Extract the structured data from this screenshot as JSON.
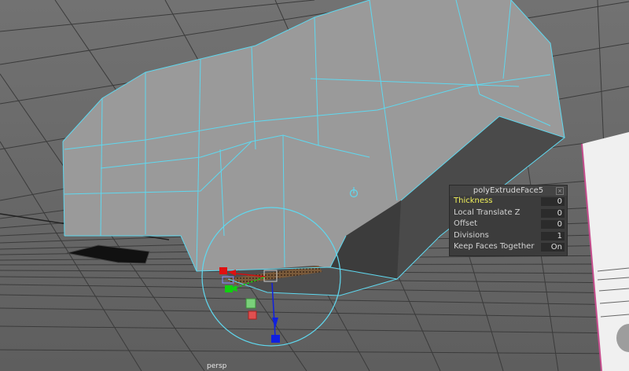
{
  "viewport": {
    "camera_label": "persp",
    "background": "#6b6b6b",
    "wire_color": "#5fd8ef"
  },
  "extrude_panel": {
    "title": "polyExtrudeFace5",
    "close_icon": "close-icon",
    "rows": [
      {
        "label": "Thickness",
        "value": "0",
        "active": true
      },
      {
        "label": "Local Translate Z",
        "value": "0",
        "active": false
      },
      {
        "label": "Offset",
        "value": "0",
        "active": false
      },
      {
        "label": "Divisions",
        "value": "1",
        "active": false
      },
      {
        "label": "Keep Faces Together",
        "value": "On",
        "active": false
      }
    ]
  },
  "manipulator": {
    "x_axis_color": "#e01010",
    "y_axis_color": "#10d010",
    "z_axis_color": "#1020e0",
    "icons": [
      "move-manipulator-icon",
      "pivot-icon"
    ]
  }
}
